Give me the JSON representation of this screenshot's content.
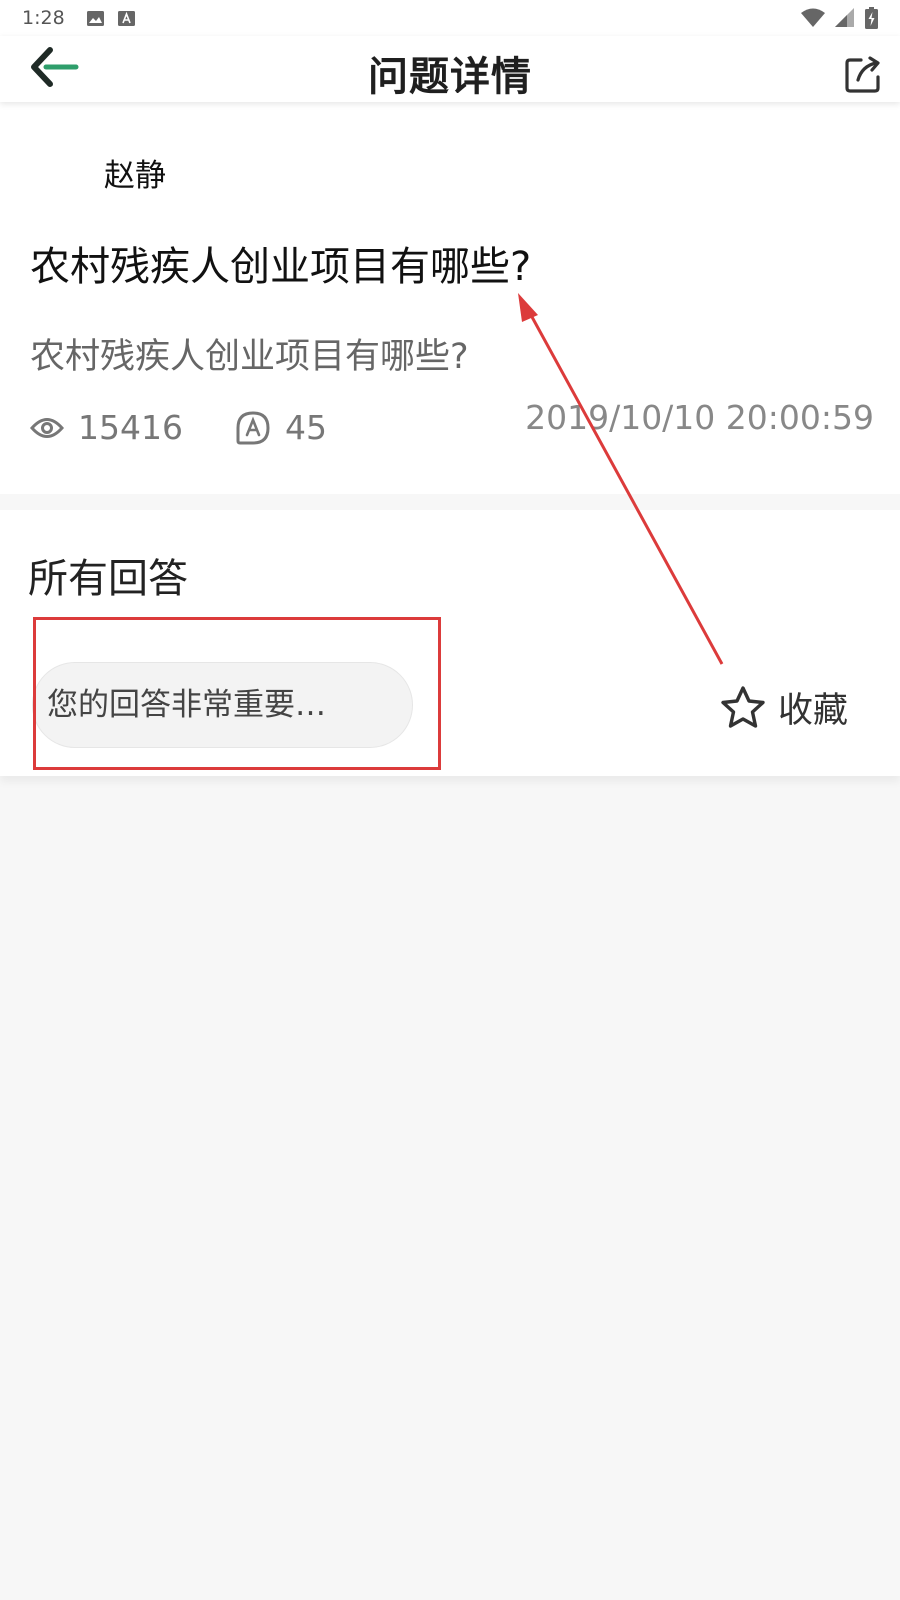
{
  "status_bar": {
    "time": "1:28",
    "left_icons": [
      "image-icon",
      "a-icon"
    ],
    "right_icons": [
      "wifi-icon",
      "signal-icon",
      "battery-icon"
    ]
  },
  "header": {
    "title": "问题详情",
    "back_icon": "back-arrow-icon",
    "share_icon": "share-icon",
    "accent_color": "#2e9e6b"
  },
  "question": {
    "author": "赵静",
    "title": "农村残疾人创业项目有哪些?",
    "description": "农村残疾人创业项目有哪些?",
    "views": "15416",
    "answers_count": "45",
    "posted_at": "2019/10/10 20:00:59"
  },
  "answers": {
    "heading": "所有回答"
  },
  "answer_bar": {
    "input_placeholder": "您的回答非常重要…",
    "favorite_label": "收藏"
  },
  "annotation": {
    "color": "#dc3b3b"
  }
}
